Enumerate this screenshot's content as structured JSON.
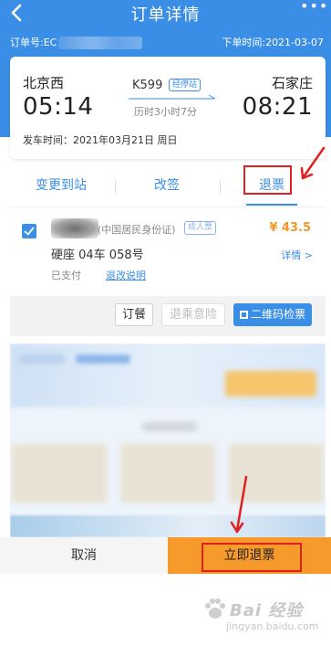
{
  "header": {
    "title": "订单详情",
    "order_label": "订单号:EC",
    "order_time": "下单时间:2021-03-07"
  },
  "trip": {
    "from_city": "北京西",
    "from_time": "05:14",
    "to_city": "石家庄",
    "to_time": "08:21",
    "train_no": "K599",
    "stops_label": "经停站",
    "duration": "历时3小时7分",
    "depart_date": "发车时间：2021年03月21日 周日"
  },
  "tabs": [
    {
      "label": "变更到站"
    },
    {
      "label": "改签"
    },
    {
      "label": "退票"
    }
  ],
  "passenger": {
    "id_type": "(中国居民身份证)",
    "ticket_type": "成人票",
    "price": "¥ 43.5",
    "seat": "硬座 04车 058号",
    "detail_link": "详情 >",
    "status": "已支付",
    "refund_note": "退改说明"
  },
  "actions": {
    "order_meal": "订餐",
    "refund_insurance": "退乘意险",
    "qr_check": "二维码检票"
  },
  "bottom": {
    "cancel": "取消",
    "confirm": "立即退票"
  },
  "watermark": {
    "brand": "Bai 经验",
    "url": "jingyan.baidu.com"
  },
  "colors": {
    "header_blue": "#3a8ee6",
    "accent_orange": "#f79a2c",
    "annotation_red": "#e02020"
  }
}
